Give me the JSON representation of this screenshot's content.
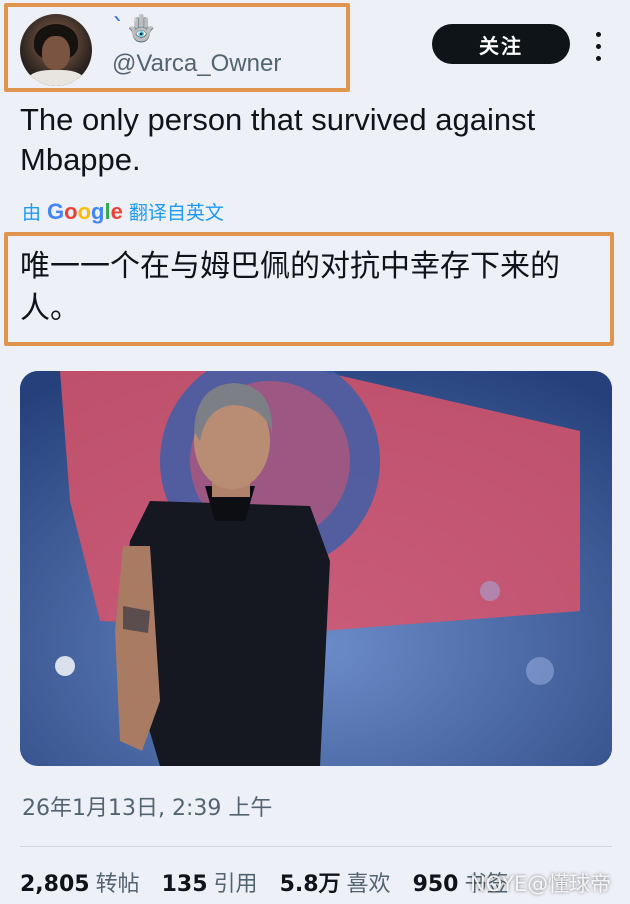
{
  "header": {
    "display_name_emoji": "`🪬",
    "handle": "@Varca_Owner",
    "follow_label": "关注"
  },
  "tweet": {
    "text": "The only person that survived against Mbappe.",
    "translation_prefix": "由",
    "translation_provider": "Google",
    "translation_suffix": "翻译自英文",
    "translated_text": "唯一一个在与姆巴佩的对抗中幸存下来的人。"
  },
  "media": {
    "description": "photo"
  },
  "footer": {
    "timestamp": "26年1月13日, 2:39 上午",
    "stats": [
      {
        "value": "2,805",
        "label": "转帖"
      },
      {
        "value": "135",
        "label": "引用"
      },
      {
        "value": "5.8万",
        "label": "喜欢"
      },
      {
        "value": "950",
        "label": "书签"
      }
    ],
    "watermark": "NOYE@懂球帝"
  },
  "colors": {
    "highlight": "#e0954f",
    "link": "#1d9bf0",
    "button_bg": "#0f1419"
  }
}
